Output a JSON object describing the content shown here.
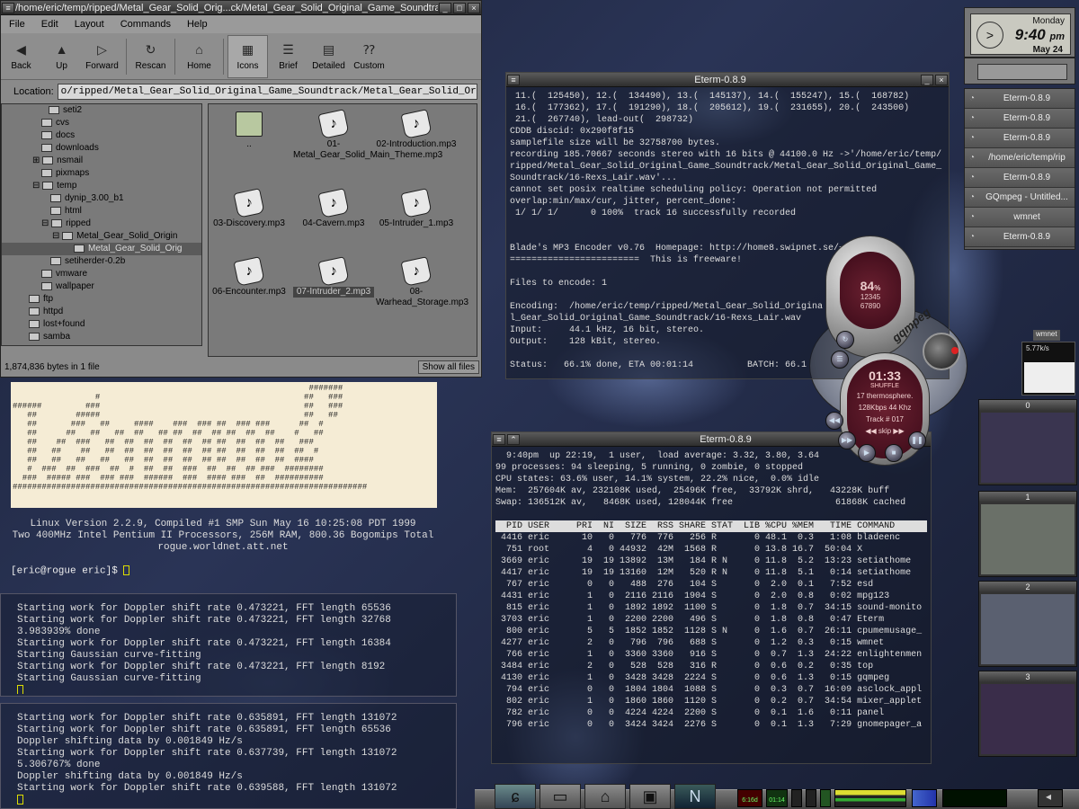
{
  "gmc": {
    "title": "/home/eric/temp/ripped/Metal_Gear_Solid_Orig...ck/Metal_Gear_Solid_Original_Game_Soundtrack",
    "menu": [
      "File",
      "Edit",
      "Layout",
      "Commands",
      "Help"
    ],
    "toolbar": [
      "Back",
      "Up",
      "Forward",
      "Rescan",
      "Home",
      "Icons",
      "Brief",
      "Detailed",
      "Custom"
    ],
    "location_label": "Location:",
    "location_value": "o/ripped/Metal_Gear_Solid_Original_Game_Soundtrack/Metal_Gear_Solid_Original_Game_Soundtrack",
    "tree": [
      "seti2",
      "cvs",
      "docs",
      "downloads",
      "nsmail",
      "pixmaps",
      "temp",
      "dynip_3.00_b1",
      "html",
      "ripped",
      "Metal_Gear_Solid_Origin",
      "Metal_Gear_Solid_Orig",
      "setiherder-0.2b",
      "vmware",
      "wallpaper",
      "ftp",
      "httpd",
      "lost+found",
      "samba"
    ],
    "files": [
      "..",
      "01-Metal_Gear_Solid_Main_Theme.mp3",
      "02-Introduction.mp3",
      "03-Discovery.mp3",
      "04-Cavern.mp3",
      "05-Intruder_1.mp3",
      "06-Encounter.mp3",
      "07-Intruder_2.mp3",
      "08-Warhead_Storage.mp3"
    ],
    "status": "1,874,836 bytes in 1 file",
    "show_all": "Show all files"
  },
  "banner": {
    "art": [
      "                                                             #######",
      "                 #                                          ##   ###",
      "######         ###                                          ##   ###",
      "   ##        #####                                          ##   ##",
      "   ##       ###   ##     ####    ###  ### ##  ### ###      ##  #",
      "   ##      ##   ##   ##  ##   ## ##  ##  ## ##  ##  ##    #   ##",
      "   ##    ##  ###   ##  ##  ##  ##  ##  ## ##  ##  ##  ##   ###",
      "   ##   ##    ##   ##  ##  ##  ##  ##  ## ##  ##  ##  ##  ##  #",
      "   ##   ##   ##   ##   ##  ##  ##  ##  ## ##  ##  ##  ##  ####",
      "   #  ###  ##  ###  ##  #  ##  ##  ###  ##  ##  ## ###  ########",
      "  ###  ##### ###  ### ###  ######  ###  #### ###  ##  ##########",
      "#########################################################################"
    ],
    "line1": "Linux Version 2.2.9, Compiled #1 SMP Sun May 16 10:25:08 PDT 1999",
    "line2": "Two 400MHz Intel Pentium II Processors, 256M RAM, 800.36 Bogomips Total",
    "line3": "rogue.worldnet.att.net",
    "prompt": "[eric@rogue eric]$ "
  },
  "seti1": [
    "Starting work for Doppler shift rate 0.473221, FFT length 65536",
    "Starting work for Doppler shift rate 0.473221, FFT length 32768",
    "3.983939% done",
    "Starting work for Doppler shift rate 0.473221, FFT length 16384",
    "Starting Gaussian curve-fitting",
    "Starting work for Doppler shift rate 0.473221, FFT length 8192",
    "Starting Gaussian curve-fitting"
  ],
  "seti2": [
    "Starting work for Doppler shift rate 0.635891, FFT length 131072",
    "Starting work for Doppler shift rate 0.635891, FFT length 65536",
    "Doppler shifting data by 0.001849 Hz/s",
    "Starting work for Doppler shift rate 0.637739, FFT length 131072",
    "5.306767% done",
    "Doppler shifting data by 0.001849 Hz/s",
    "Starting work for Doppler shift rate 0.639588, FFT length 131072"
  ],
  "eterm1": {
    "title": "Eterm-0.8.9",
    "lines": [
      " 11.(  125450), 12.(  134490), 13.(  145137), 14.(  155247), 15.(  168782)",
      " 16.(  177362), 17.(  191290), 18.(  205612), 19.(  231655), 20.(  243500)",
      " 21.(  267740), lead-out(  298732)",
      "CDDB discid: 0x290f8f15",
      "samplefile size will be 32758700 bytes.",
      "recording 185.70667 seconds stereo with 16 bits @ 44100.0 Hz ->'/home/eric/temp/",
      "ripped/Metal_Gear_Solid_Original_Game_Soundtrack/Metal_Gear_Solid_Original_Game_",
      "Soundtrack/16-Rexs_Lair.wav'...",
      "cannot set posix realtime scheduling policy: Operation not permitted",
      "overlap:min/max/cur, jitter, percent_done:",
      " 1/ 1/ 1/      0 100%  track 16 successfully recorded",
      "",
      "",
      "Blade's MP3 Encoder v0.76  Homepage: http://home8.swipnet.se/~",
      "========================  This is freeware!",
      "",
      "Files to encode: 1",
      "",
      "Encoding:  /home/eric/temp/ripped/Metal_Gear_Solid_Origina            ta",
      "l_Gear_Solid_Original_Game_Soundtrack/16-Rexs_Lair.wav",
      "Input:     44.1 kHz, 16 bit, stereo.",
      "Output:    128 kBit, stereo.",
      "",
      "Status:   66.1% done, ETA 00:01:14          BATCH: 66.1"
    ]
  },
  "etop": {
    "title": "Eterm-0.8.9",
    "lines": [
      "  9:40pm  up 22:19,  1 user,  load average: 3.32, 3.80, 3.64",
      "99 processes: 94 sleeping, 5 running, 0 zombie, 0 stopped",
      "CPU states: 63.6% user, 14.1% system, 22.2% nice,  0.0% idle",
      "Mem:  257604K av, 232108K used,  25496K free,  33792K shrd,   43228K buff",
      "Swap: 136512K av,   8468K used, 128044K free                   61868K cached",
      ""
    ],
    "header": "  PID USER     PRI  NI  SIZE  RSS SHARE STAT  LIB %CPU %MEM   TIME COMMAND",
    "procs": [
      " 4416 eric      10   0   776  776   256 R       0 48.1  0.3   1:08 bladeenc",
      "  751 root       4   0 44932  42M  1568 R       0 13.8 16.7  50:04 X",
      " 3669 eric      19  19 13892  13M   184 R N     0 11.8  5.2  13:23 setiathome",
      " 4417 eric      19  19 13160  12M   520 R N     0 11.8  5.1   0:14 setiathome",
      "  767 eric       0   0   488  276   104 S       0  2.0  0.1   7:52 esd",
      " 4431 eric       1   0  2116 2116  1904 S       0  2.0  0.8   0:02 mpg123",
      "  815 eric       1   0  1892 1892  1100 S       0  1.8  0.7  34:15 sound-monito",
      " 3703 eric       1   0  2200 2200   496 S       0  1.8  0.8   0:47 Eterm",
      "  800 eric       5   5  1852 1852  1128 S N     0  1.6  0.7  26:11 cpumemusage_",
      " 4277 eric       2   0   796  796   688 S       0  1.2  0.3   0:15 wmnet",
      "  766 eric       1   0  3360 3360   916 S       0  0.7  1.3  24:22 enlightenmen",
      " 3484 eric       2   0   528  528   316 R       0  0.6  0.2   0:35 top",
      " 4130 eric       1   0  3428 3428  2224 S       0  0.6  1.3   0:15 gqmpeg",
      "  794 eric       0   0  1804 1804  1088 S       0  0.3  0.7  16:09 asclock_appl",
      "  802 eric       1   0  1860 1860  1120 S       0  0.2  0.7  34:54 mixer_applet",
      "  782 eric       0   0  4224 4224  2200 S       0  0.1  1.6   0:11 panel",
      "  796 eric       0   0  3424 3424  2276 S       0  0.1  1.3   7:29 gnomepager_a"
    ]
  },
  "clock": {
    "day": "Monday",
    "time": "9:40",
    "ampm": "pm",
    "date": "May 24"
  },
  "tasks": [
    "Eterm-0.8.9",
    "Eterm-0.8.9",
    "Eterm-0.8.9",
    "/home/eric/temp/rip",
    "Eterm-0.8.9",
    "GQmpeg - Untitled...",
    "wmnet",
    "Eterm-0.8.9"
  ],
  "pager": [
    "0",
    "1",
    "2",
    "3"
  ],
  "wmnet": {
    "label": "wmnet",
    "rate": "5.77k/s"
  },
  "gqmpeg": {
    "percent": "84",
    "pct_sym": "%",
    "nums1": "12345",
    "nums2": "67890",
    "time": "01:33",
    "shuffle": "SHUFFLE",
    "title": "17 thermosphere.",
    "rate": "128Kbps 44 Khz",
    "track": "Track # 017",
    "skip": "skip",
    "logo": "gqmpeg"
  },
  "panel": {
    "clock1": "6:16d",
    "clock2": "01:14"
  }
}
